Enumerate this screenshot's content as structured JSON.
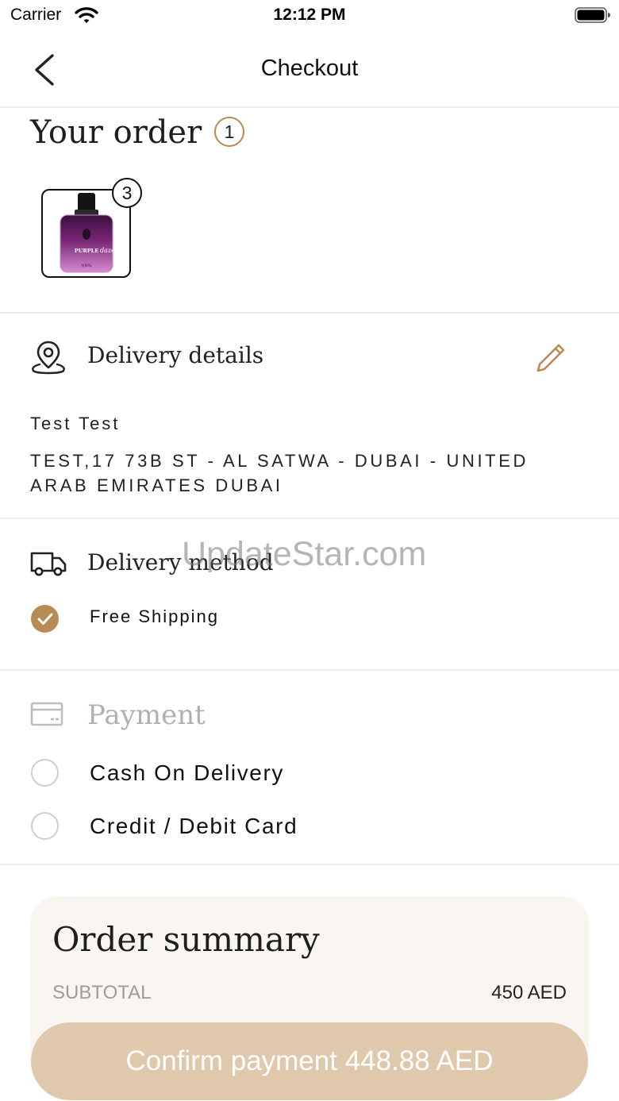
{
  "status_bar": {
    "carrier": "Carrier",
    "time": "12:12 PM"
  },
  "header": {
    "title": "Checkout"
  },
  "order": {
    "title": "Your order",
    "count": "1",
    "product_quantity": "3",
    "product_image_text": {
      "brand_line": "PURPLE",
      "script_line": "daze",
      "maker": "AJMAL"
    }
  },
  "delivery": {
    "title": "Delivery details",
    "name": "Test Test",
    "address": "TEST,17 73B ST - AL SATWA - DUBAI - UNITED ARAB EMIRATES DUBAI"
  },
  "method": {
    "title": "Delivery method",
    "option": "Free Shipping"
  },
  "payment": {
    "title": "Payment",
    "options": [
      "Cash On Delivery",
      "Credit / Debit Card"
    ]
  },
  "summary": {
    "title": "Order summary",
    "subtotal_label": "SUBTOTAL",
    "subtotal_value": "450 AED"
  },
  "confirm": {
    "label": "Confirm payment 448.88 AED"
  },
  "watermark": "UpdateStar.com",
  "colors": {
    "accent": "#b88a54",
    "button": "#dfc8ab",
    "card": "#f9f5f1",
    "divider": "#ececec"
  }
}
